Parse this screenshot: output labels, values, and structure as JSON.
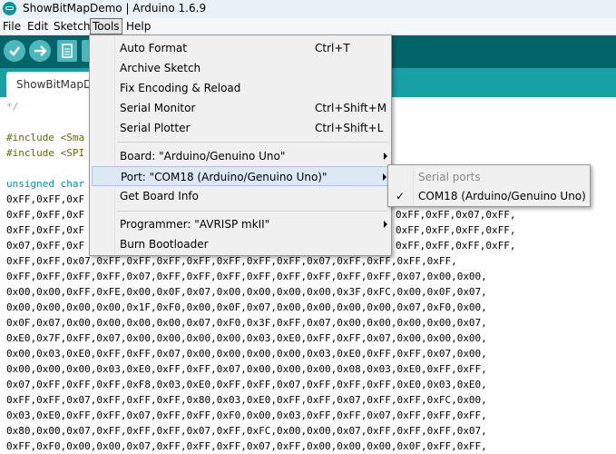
{
  "window": {
    "title": "ShowBitMapDemo | Arduino 1.6.9"
  },
  "menubar": {
    "items": [
      "File",
      "Edit",
      "Sketch",
      "Tools",
      "Help"
    ]
  },
  "tab": {
    "label": "ShowBitMapDemo"
  },
  "code": {
    "lines": [
      "*/",
      "",
      "#include <Sma",
      "#include <SPI",
      "",
      "unsigned char",
      "0xFF,0xFF,0xF",
      "0xFF,0xFF,0xF",
      "0xFF,0xFF,0xF",
      "0x07,0xFF,0xF",
      "0xFF,0xFF,0x07,0xFF,0xFF,0xFF,0xFF,0xFF,0xFF,0xFF,0x07,0xFF,0xFF,0xFF,0xFF,",
      "0xFF,0xFF,0xFF,0xFF,0x07,0xFF,0xFF,0xFF,0xFF,0xFF,0xFF,0xFF,0xFF,0x07,0x00,0x00,",
      "0x00,0x00,0xFF,0xFE,0x00,0x0F,0x07,0x00,0x00,0x00,0x00,0x3F,0xFC,0x00,0x0F,0x07,",
      "0x00,0x00,0x00,0x00,0x1F,0xF0,0x00,0x0F,0x07,0x00,0x00,0x00,0x00,0x07,0xF0,0x00,",
      "0x0F,0x07,0x00,0x00,0x00,0x00,0x07,0xF0,0x3F,0xFF,0x07,0x00,0x00,0x00,0x00,0x07,",
      "0xE0,0x7F,0xFF,0x07,0x00,0x00,0x00,0x00,0x03,0xE0,0xFF,0xFF,0x07,0x00,0x00,0x00,",
      "0x00,0x03,0xE0,0xFF,0xFF,0x07,0x00,0x00,0x00,0x00,0x03,0xE0,0xFF,0xFF,0x07,0x00,",
      "0x00,0x00,0x00,0x03,0xE0,0xFF,0xFF,0x07,0x00,0x00,0x00,0x08,0x03,0xE0,0xFF,0xFF,",
      "0x07,0xFF,0xFF,0xFF,0xF8,0x03,0xE0,0xFF,0xFF,0x07,0xFF,0xFF,0xFF,0xE0,0x03,0xE0,",
      "0xFF,0xFF,0x07,0xFF,0xFF,0xFF,0x80,0x03,0xE0,0xFF,0xFF,0x07,0xFF,0xFF,0xFC,0x00,",
      "0x03,0xE0,0xFF,0xFF,0x07,0xFF,0xFF,0xF0,0x00,0x03,0xFF,0xFF,0x07,0xFF,0xFF,0xFF,",
      "0x80,0x00,0x07,0xFF,0xFF,0xFF,0x07,0xFF,0xFC,0x00,0x00,0x07,0xFF,0xFF,0xFF,0x07,",
      "0xFF,0xF0,0x00,0x00,0x07,0xFF,0xFF,0xFF,0x07,0xFF,0x00,0x00,0x00,0x0F,0xFF,0xFF,"
    ],
    "right_fragments": [
      {
        "line": 7,
        "text": "0xFF,0xFF,0x07,0xFF,"
      },
      {
        "line": 8,
        "text": "0xFF,0xFF,0xFF,0xFF,"
      },
      {
        "line": 9,
        "text": "0xFF,0xFF,0xFF,0xFF,"
      }
    ]
  },
  "tools_menu": {
    "items": [
      {
        "label": "Auto Format",
        "shortcut": "Ctrl+T"
      },
      {
        "label": "Archive Sketch",
        "shortcut": ""
      },
      {
        "label": "Fix Encoding & Reload",
        "shortcut": ""
      },
      {
        "label": "Serial Monitor",
        "shortcut": "Ctrl+Shift+M"
      },
      {
        "label": "Serial Plotter",
        "shortcut": "Ctrl+Shift+L"
      },
      {
        "label": "Board: \"Arduino/Genuino Uno\"",
        "shortcut": "",
        "submenu": true
      },
      {
        "label": "Port: \"COM18 (Arduino/Genuino Uno)\"",
        "shortcut": "",
        "submenu": true,
        "highlighted": true
      },
      {
        "label": "Get Board Info",
        "shortcut": ""
      },
      {
        "label": "Programmer: \"AVRISP mkII\"",
        "shortcut": "",
        "submenu": true
      },
      {
        "label": "Burn Bootloader",
        "shortcut": ""
      }
    ]
  },
  "port_submenu": {
    "header": "Serial ports",
    "items": [
      {
        "label": "COM18 (Arduino/Genuino Uno)",
        "checked": true,
        "check": "✓"
      }
    ]
  },
  "colors": {
    "toolbar": "#006468",
    "tabstrip": "#17a1a5",
    "button": "#4db7bb",
    "highlight": "#dde8f5"
  },
  "icons": [
    "arduino-logo-icon",
    "verify-check-icon",
    "upload-arrow-icon",
    "new-sketch-icon",
    "submenu-arrow-icon",
    "checkmark-icon"
  ]
}
